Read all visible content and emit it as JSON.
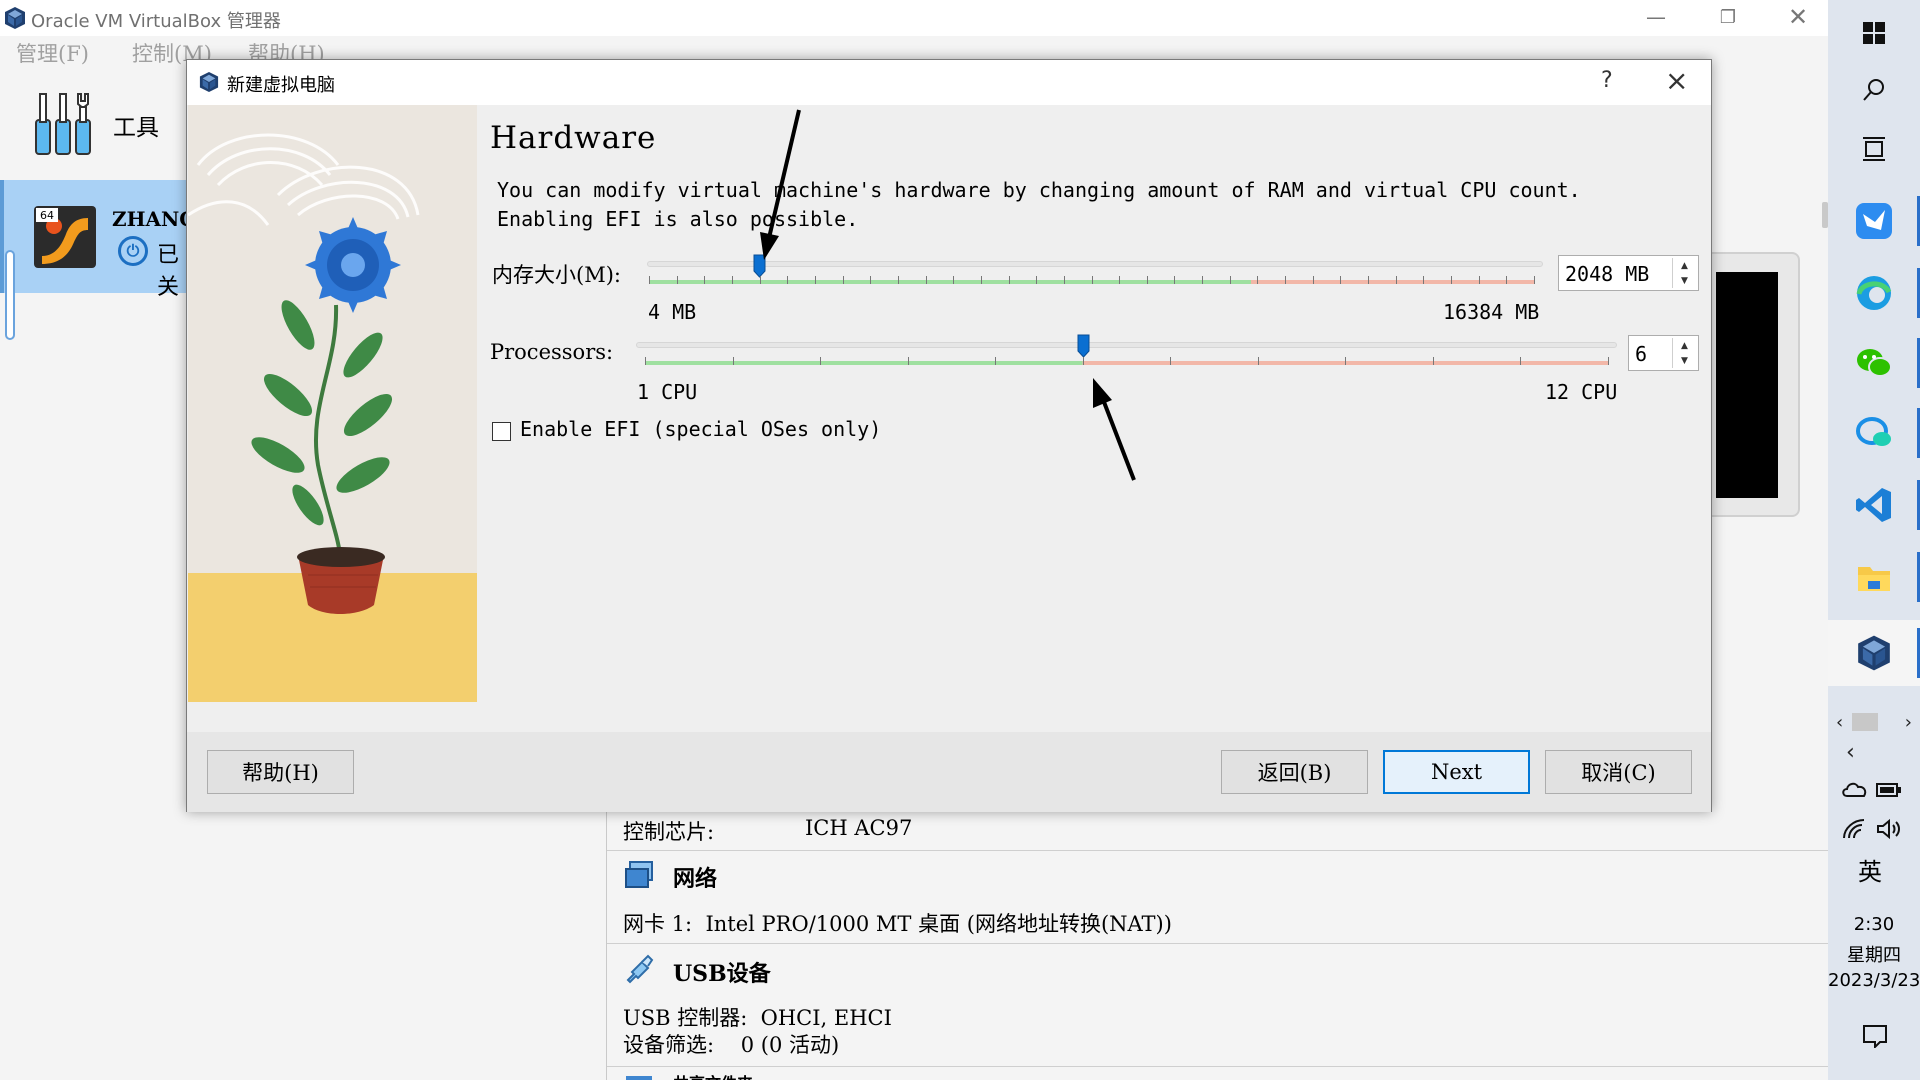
{
  "main_window": {
    "title": "Oracle VM VirtualBox 管理器",
    "menu": [
      {
        "label": "管理(F)"
      },
      {
        "label": "控制(M)"
      },
      {
        "label": "帮助(H)"
      }
    ],
    "tools_label": "工具",
    "vm": {
      "badge": "64",
      "name": "ZHANGY",
      "state": "已关"
    },
    "details": {
      "audio_controller_label": "控制芯片:",
      "audio_controller_value": "ICH AC97",
      "network_heading": "网络",
      "network_line": "网卡 1:  Intel PRO/1000 MT 桌面 (网络地址转换(NAT))",
      "usb_heading": "USB设备",
      "usb_controller_line": "USB 控制器:  OHCI, EHCI",
      "usb_filter_line": "设备筛选:    0 (0 活动)",
      "shared_folders_heading": "共享文件夹"
    }
  },
  "dialog": {
    "title": "新建虚拟电脑",
    "help_symbol": "?",
    "heading": "Hardware",
    "description": "You can modify virtual machine's hardware by changing amount of RAM and virtual CPU count. Enabling EFI is also possible.",
    "memory": {
      "label": "内存大小(M):",
      "min_label": "4 MB",
      "max_label": "16384 MB",
      "spin_value": "2048 MB",
      "value_mb": 2048,
      "min_mb": 4,
      "max_mb": 16384
    },
    "processors": {
      "label": "Processors:",
      "min_label": "1 CPU",
      "max_label": "12 CPU",
      "spin_value": "6",
      "value": 6,
      "min": 1,
      "max": 12
    },
    "efi": {
      "label": "Enable EFI (special OSes only)",
      "checked": false
    },
    "buttons": {
      "help": "帮助(H)",
      "back": "返回(B)",
      "next": "Next",
      "cancel": "取消(C)"
    }
  },
  "taskbar": {
    "ime": "英",
    "time": "2:30",
    "weekday": "星期四",
    "date": "2023/3/23"
  },
  "colors": {
    "accent": "#0078d7",
    "slider_green": "#9fe0a0",
    "slider_red": "#f2b7a8",
    "selection": "#a9d1f5"
  }
}
